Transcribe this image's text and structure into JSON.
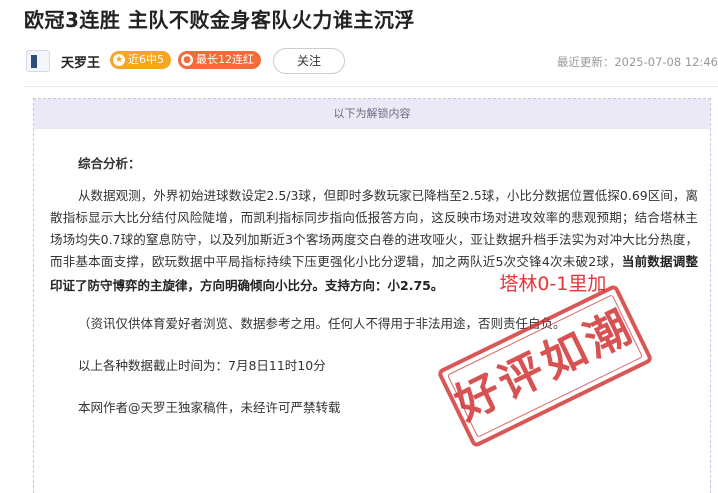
{
  "article": {
    "title": "欧冠3连胜 主队不败金身客队火力谁主沉浮"
  },
  "author": {
    "name": "天罗王",
    "badges": [
      {
        "icon": "star-icon",
        "text": "近6中5"
      },
      {
        "icon": "fire-icon",
        "text": "最长12连红"
      }
    ],
    "follow_label": "关注"
  },
  "meta": {
    "update_time": "最近更新：2025-07-08 12:46"
  },
  "unlock": {
    "header": "以下为解锁内容"
  },
  "analysis": {
    "section_title": "综合分析：",
    "body_normal": "从数据观测，外界初始进球数设定2.5/3球，但即时多数玩家已降档至2.5球，小比分数据位置低探0.69区间，离散指标显示大比分结付风险陡增，而凯利指标同步指向低报答方向，这反映市场对进攻效率的悲观预期；结合塔林主场场均失0.7球的窒息防守，以及列加斯近3个客场两度交白卷的进攻哑火，亚让数据升档手法实为对冲大比分热度，而非基本面支撑，欧玩数据中平局指标持续下压更强化小比分逻辑，加之两队近5次交锋4次未破2球，",
    "body_bold": "当前数据调整印证了防守博弈的主旋律，方向明确倾向小比分。支持方向：小2.75。",
    "red_note": "塔林0-1里加",
    "disclaimer": "（资讯仅供体育爱好者浏览、数据参考之用。任何人不得用于非法用途，否则责任自负。",
    "data_time": "以上各种数据截止时间为：7月8日11时10分",
    "copyright": "本网作者@天罗王独家稿件，未经许可严禁转载"
  },
  "stamp": {
    "text": "好评如潮",
    "color": "#cd2828"
  },
  "colors": {
    "badge_orange": "#f5a623",
    "badge_red": "#f26b3a",
    "note_red": "#e83535",
    "unlock_bg": "#ece9f7"
  }
}
